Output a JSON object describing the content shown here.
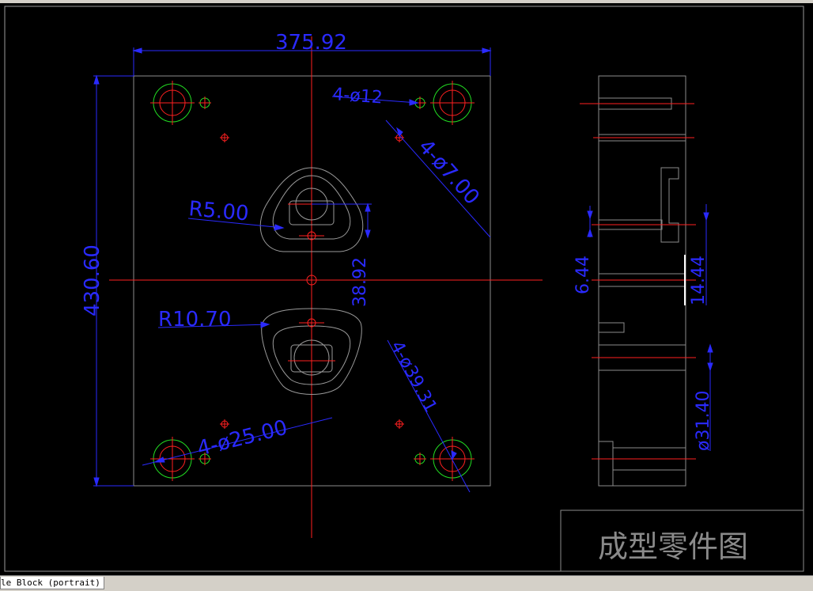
{
  "drawing": {
    "dimensions": {
      "width": "375.92",
      "height": "430.60",
      "holes_small": "4-ø12",
      "holes_pin": "4-ø7.00",
      "radius_top": "R5.00",
      "radius_bottom": "R10.70",
      "gap": "38.92",
      "holes_large": "4-ø25.00",
      "holes_counter": "4-ø39.31",
      "side_a": "6.44",
      "side_b": "14.44",
      "side_dia": "ø31.40"
    },
    "title_block": {
      "title": "成型零件图"
    },
    "colors": {
      "background": "#000000",
      "outline": "#8c8c8c",
      "centerline": "#ff2020",
      "dimension": "#2a2aff",
      "hole": "#22dd22",
      "white": "#ffffff"
    }
  },
  "layout_tab": {
    "label": "le Block (portrait)"
  }
}
